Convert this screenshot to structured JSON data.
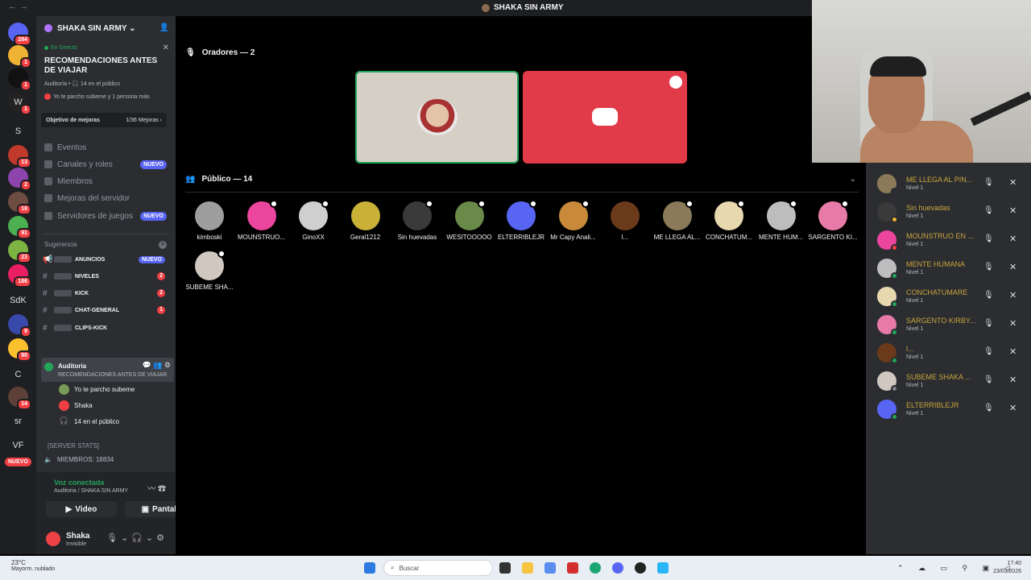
{
  "window": {
    "nav": "← →",
    "title": "SHAKA SIN ARMY"
  },
  "rail": {
    "servers": [
      {
        "label": "",
        "badge": "284",
        "color": "#5865f2"
      },
      {
        "label": "",
        "badge": "1",
        "color": "#f0b232"
      },
      {
        "label": "",
        "badge": "1",
        "color": "#111111"
      },
      {
        "label": "W",
        "badge": "1",
        "color": "#222222"
      },
      {
        "label": "S",
        "badge": "",
        "color": "transparent"
      },
      {
        "label": "",
        "badge": "13",
        "color": "#c0392b"
      },
      {
        "label": "",
        "badge": "2",
        "color": "#8e44ad"
      },
      {
        "label": "",
        "badge": "18",
        "color": "#6d4c41"
      },
      {
        "label": "",
        "badge": "91",
        "color": "#4caf50"
      },
      {
        "label": "",
        "badge": "23",
        "color": "#7cb342"
      },
      {
        "label": "",
        "badge": "186",
        "color": "#e91e63"
      },
      {
        "label": "SdK",
        "badge": "",
        "color": "transparent"
      },
      {
        "label": "",
        "badge": "9",
        "color": "#3949ab"
      },
      {
        "label": "",
        "badge": "90",
        "color": "#fbc02d"
      },
      {
        "label": "C",
        "badge": "",
        "color": "transparent"
      },
      {
        "label": "",
        "badge": "14",
        "color": "#5d4037"
      },
      {
        "label": "sr",
        "badge": "",
        "color": "transparent"
      },
      {
        "label": "VF",
        "badge": "",
        "color": "transparent"
      }
    ],
    "nuevo": "NUEVO"
  },
  "sidebar": {
    "guild_name": "SHAKA SIN ARMY ⌄",
    "event": {
      "live": "En Directo",
      "title": "RECOMENDACIONES ANTES DE VIAJAR",
      "meta": "Auditoría • 🎧 14 en el público",
      "meta2": "Yo te parcho subeme y 1 persona más"
    },
    "boost": {
      "label": "Objetivo de mejoras",
      "value": "1/36 Mejoras ›"
    },
    "menu": [
      {
        "label": "Eventos",
        "pill": ""
      },
      {
        "label": "Canales y roles",
        "pill": "NUEVO"
      },
      {
        "label": "Miembros",
        "pill": ""
      },
      {
        "label": "Mejoras del servidor",
        "pill": ""
      },
      {
        "label": "Servidores de juegos",
        "pill": "NUEVO"
      }
    ],
    "suggestion_label": "Sugerencia",
    "channels": [
      {
        "name": "ANUNCIOS",
        "pill": "NUEVO",
        "type": "new"
      },
      {
        "name": "NIVELES",
        "pill": "2",
        "type": "count"
      },
      {
        "name": "KICK",
        "pill": "2",
        "type": "count"
      },
      {
        "name": "CHAT-GENERAL",
        "pill": "1",
        "type": "count"
      },
      {
        "name": "CLIPS-KICK",
        "pill": "",
        "type": "none"
      }
    ],
    "stage_channel": {
      "name": "Auditoria",
      "sub": "RECOMENDACIONES ANTES DE VIAJAR"
    },
    "stage_members": [
      {
        "name": "Yo te parcho subeme",
        "color": "#7a9a5a"
      },
      {
        "name": "Shaka",
        "color": "#f23f43"
      },
      {
        "name": "14 en el público",
        "color": "transparent"
      }
    ],
    "stats_label": "[SERVER STATS]",
    "stats_members": "MIEMBROS: 18834",
    "voice": {
      "status": "Voz conectada",
      "sub": "Auditoria / SHAKA SIN ARMY",
      "video_btn": "Video",
      "screen_btn": "Pantalla"
    },
    "user": {
      "name": "Shaka",
      "status": "Invisible"
    }
  },
  "stage": {
    "speakers_header": "Oradores — 2",
    "audience_header": "Público — 14",
    "audience": [
      {
        "name": "kimboski",
        "color": "#9e9e9e"
      },
      {
        "name": "MOUNSTRUO...",
        "color": "#eb459e"
      },
      {
        "name": "GinoXX",
        "color": "#cfcfcf"
      },
      {
        "name": "Geral1212",
        "color": "#c9b037"
      },
      {
        "name": "Sin huevadas",
        "color": "#3a3a3a"
      },
      {
        "name": "WESITOOOOO",
        "color": "#6a8a4a"
      },
      {
        "name": "ELTERRIBLEJR",
        "color": "#5865f2"
      },
      {
        "name": "Mr Capy Anali...",
        "color": "#c88a3a"
      },
      {
        "name": "l...",
        "color": "#6b3a1a"
      },
      {
        "name": "ME LLEGA AL...",
        "color": "#8a7a5a"
      },
      {
        "name": "CONCHATUM...",
        "color": "#e8d8b0"
      },
      {
        "name": "MENTE HUM...",
        "color": "#bdbdbd"
      },
      {
        "name": "SARGENTO KI...",
        "color": "#e77aa7"
      },
      {
        "name": "SUBEME SHA...",
        "color": "#d0c8c0"
      }
    ]
  },
  "members_panel": [
    {
      "name": "ME LLEGA AL PIN...",
      "level": "Nivel 1",
      "color": "#8a7a5a",
      "status": "#2b2d31"
    },
    {
      "name": "Sin huevadas",
      "level": "Nivel 1",
      "color": "#3a3a3a",
      "status": "#f0b232"
    },
    {
      "name": "MOUNSTRUO EN ...",
      "level": "Nivel 1",
      "color": "#eb459e",
      "status": "#f23f43"
    },
    {
      "name": "MENTE HUMANA",
      "level": "Nivel 1",
      "color": "#bdbdbd",
      "status": "#23a55a"
    },
    {
      "name": "CONCHATUMARE",
      "level": "Nivel 1",
      "color": "#e8d8b0",
      "status": "#23a55a"
    },
    {
      "name": "SARGENTO KIRBY...",
      "level": "Nivel 1",
      "color": "#e77aa7",
      "status": "#23a55a"
    },
    {
      "name": "l...",
      "level": "Nivel 1",
      "color": "#6b3a1a",
      "status": "#23a55a"
    },
    {
      "name": "SUBEME SHAKA ...",
      "level": "Nivel 1",
      "color": "#d0c8c0",
      "status": "#80848e"
    },
    {
      "name": "ELTERRIBLEJR",
      "level": "Nivel 1",
      "color": "#5865f2",
      "status": "#23a55a"
    }
  ],
  "taskbar": {
    "temp": "23°C",
    "weather": "Mayorm. nublado",
    "search": "Buscar",
    "time": "17:40",
    "date": "23/03/2026",
    "tray": "⌃ ☁ ▭ ⚲ ▣ ◁"
  },
  "colors": {
    "accent": "#5865f2",
    "green": "#23a55a",
    "red": "#f23f43",
    "gold": "#c9a63a"
  }
}
